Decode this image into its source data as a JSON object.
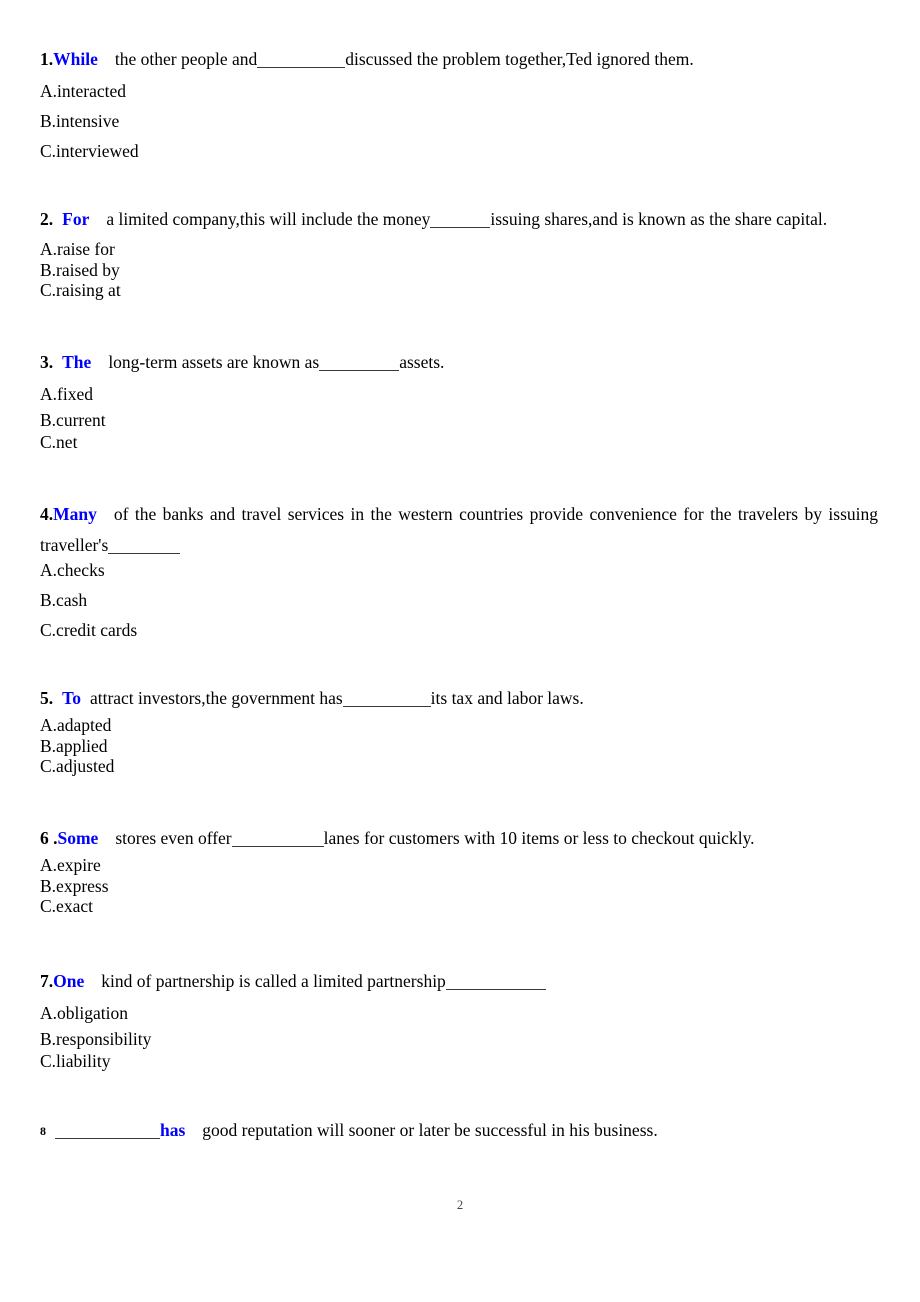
{
  "page": {
    "page_number": "2"
  },
  "questions": [
    {
      "number": "1.",
      "keyword": "While",
      "stem_part1": "the other people and",
      "stem_part2": "discussed the problem together,Ted ignored them.",
      "options": [
        "A.interacted",
        "B.intensive",
        "C.interviewed"
      ]
    },
    {
      "number": "2.",
      "keyword": "For",
      "stem_part1": "a limited company,this will include the money",
      "stem_part2": "issuing shares,and is known as the share capital.",
      "options": [
        "A.raise for",
        "B.raised by",
        "C.raising  at"
      ]
    },
    {
      "number": "3.",
      "keyword": "The",
      "stem_part1": "long-term assets are known as",
      "stem_part2": "assets.",
      "options": [
        "A.fixed",
        "B.current",
        "C.net"
      ]
    },
    {
      "number": "4.",
      "keyword": "Many",
      "stem_part1": "of the banks and travel services in the western countries provide convenience for the travelers by issuing",
      "stem_part2": "traveller's",
      "stem_part3": "",
      "options": [
        "A.checks",
        "B.cash",
        "C.credit  cards"
      ]
    },
    {
      "number": "5.",
      "keyword": "To",
      "stem_part1": "attract investors,the government has",
      "stem_part2": "its tax and labor laws.",
      "options": [
        "A.adapted",
        "B.applied",
        "C.adjusted"
      ]
    },
    {
      "number": "6 .",
      "keyword": "Some",
      "stem_part1": "stores even offer",
      "stem_part2": "lanes for customers with  10 items or less to checkout quickly.",
      "options": [
        "A.expire",
        "B.express",
        "C.exact"
      ]
    },
    {
      "number": "7.",
      "keyword": "One",
      "stem_part1": "kind of partnership is called a limited partnership",
      "stem_part2": "",
      "options": [
        "A.obligation",
        "B.responsibility",
        "C.liability"
      ]
    },
    {
      "number": "8",
      "keyword": "has",
      "stem_part1": "",
      "stem_part2": "good reputation will sooner or later be successful in his business.",
      "options": []
    }
  ],
  "colors": {
    "keyword": "#0000FF",
    "text": "#000000",
    "blank_rule": "#3a3a3a"
  }
}
